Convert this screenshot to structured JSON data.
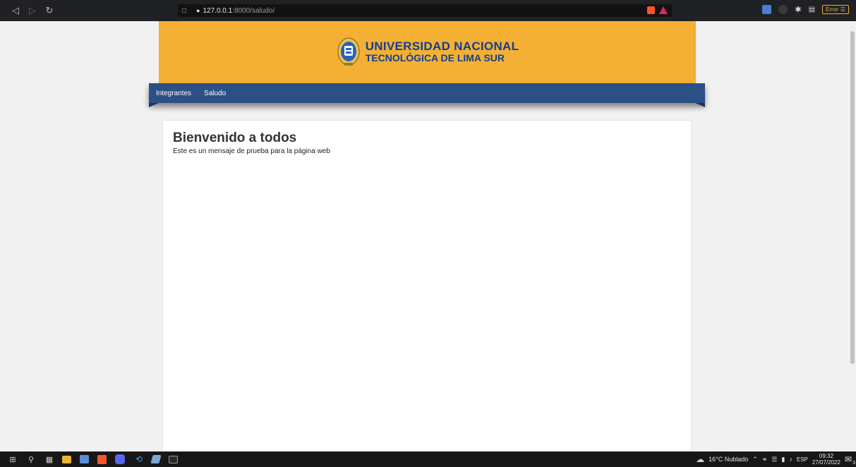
{
  "browser": {
    "url_host": "127.0.0.1",
    "url_path": ":8000/saludo/",
    "error_label": "Error"
  },
  "header": {
    "title_line1": "UNIVERSIDAD NACIONAL",
    "title_line2": "TECNOLÓGICA DE LIMA SUR"
  },
  "navbar": {
    "items": [
      {
        "label": "Integrantes"
      },
      {
        "label": "Saludo"
      }
    ]
  },
  "content": {
    "title": "Bienvenido a todos",
    "text": "Este es un mensaje de prueba para la página web"
  },
  "taskbar": {
    "weather": "16°C Nublado",
    "lang": "ESP",
    "time": "09:32",
    "date": "27/07/2022",
    "notif_count": "3"
  },
  "colors": {
    "banner": "#f4b034",
    "navbar": "#2c4f86",
    "brand_text": "#123f8f"
  }
}
